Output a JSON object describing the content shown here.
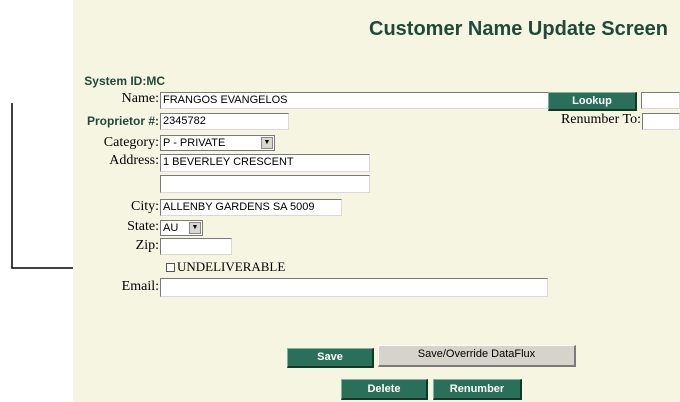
{
  "title": "Customer Name Update Screen",
  "system_id_label": "System ID:",
  "system_id_value": "MC",
  "fields": {
    "name_label": "Name:",
    "name_value": "FRANGOS EVANGELOS",
    "proprietor_label": "Proprietor #:",
    "proprietor_value": "2345782",
    "category_label": "Category:",
    "category_value": "P - PRIVATE",
    "address_label": "Address:",
    "address1_value": "1 BEVERLEY CRESCENT",
    "address2_value": "",
    "city_label": "City:",
    "city_value": "ALLENBY GARDENS SA 5009",
    "state_label": "State:",
    "state_value": "AU",
    "zip_label": "Zip:",
    "zip_value": "",
    "undeliverable_label": "UNDELIVERABLE",
    "email_label": "Email:",
    "email_value": "",
    "renumber_to_label": "Renumber To:",
    "renumber_to_value": "",
    "lookup_value": ""
  },
  "buttons": {
    "lookup": "Lookup",
    "save": "Save",
    "save_override": "Save/Override DataFlux",
    "delete": "Delete",
    "renumber": "Renumber"
  }
}
